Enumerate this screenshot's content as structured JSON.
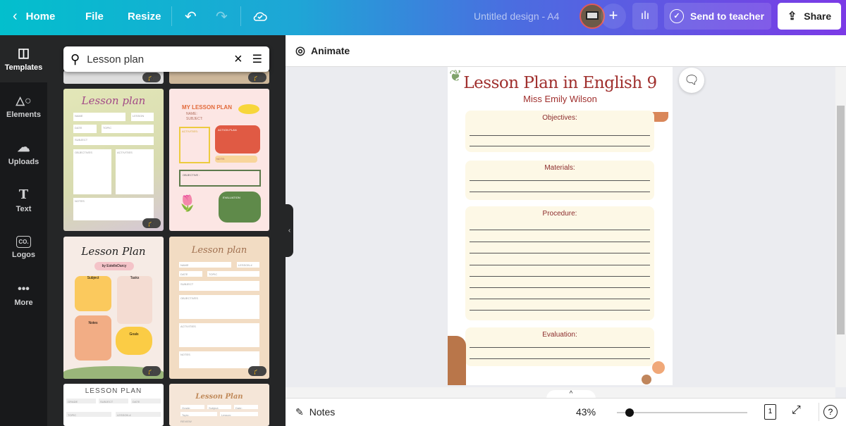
{
  "topbar": {
    "home": "Home",
    "file": "File",
    "resize": "Resize",
    "design_title": "Untitled design - A4",
    "send_to_teacher": "Send to teacher",
    "share": "Share",
    "colors": {
      "gradient_start": "#03bfcd",
      "gradient_end": "#7b3ae6"
    }
  },
  "rail": {
    "items": [
      {
        "label": "Templates",
        "icon": "templates-icon"
      },
      {
        "label": "Elements",
        "icon": "elements-icon"
      },
      {
        "label": "Uploads",
        "icon": "upload-icon"
      },
      {
        "label": "Text",
        "icon": "text-icon"
      },
      {
        "label": "Logos",
        "icon": "logo-icon"
      },
      {
        "label": "More",
        "icon": "more-icon"
      }
    ]
  },
  "search": {
    "value": "Lesson plan"
  },
  "templates": [
    {
      "title": "Lesson plan",
      "fields": [
        "NAME",
        "LESSON",
        "DATE",
        "TOPIC",
        "SUBJECT",
        "OBJECTIVES",
        "ACTIVITIES",
        "NOTES"
      ]
    },
    {
      "title": "MY LESSON PLAN",
      "fields": [
        "NAME:",
        "SUBJECT:",
        "ACTIVITIES:",
        "ACTION PLAN",
        "NOTE:",
        "OBJECTIVE :",
        "EVALUATION"
      ]
    },
    {
      "title": "Lesson Plan",
      "subtitle": "by EstelleDarcy",
      "fields": [
        "Subject",
        "Tasks",
        "Notes",
        "Goals"
      ]
    },
    {
      "title": "Lesson plan",
      "fields": [
        "NAME",
        "LESSON #",
        "DATE",
        "TOPIC",
        "SUBJECT",
        "OBJECTIVES",
        "ACTIVITIES",
        "NOTES"
      ]
    },
    {
      "title": "LESSON PLAN",
      "fields": [
        "GRADE",
        "SUBJECT",
        "DATE",
        "TOPIC",
        "LESSON #"
      ]
    },
    {
      "title": "Lesson Plan",
      "fields": [
        "Grade:",
        "Subject:",
        "Date:",
        "Topic:",
        "Lesson:",
        "REVIEW"
      ]
    }
  ],
  "editor": {
    "animate": "Animate",
    "notes": "Notes",
    "zoom": "43%",
    "zoom_level_percent": 43,
    "page_number": "1"
  },
  "document": {
    "title": "Lesson Plan in English 9",
    "teacher": "Miss Emily Wilson",
    "sections": [
      {
        "label": "Objectives:",
        "lines": 2
      },
      {
        "label": "Materials:",
        "lines": 2
      },
      {
        "label": "Procedure:",
        "lines": 8
      },
      {
        "label": "Evaluation:",
        "lines": 2
      }
    ],
    "colors": {
      "title": "#a0302e",
      "section_bg": "#fdf8e6"
    }
  }
}
